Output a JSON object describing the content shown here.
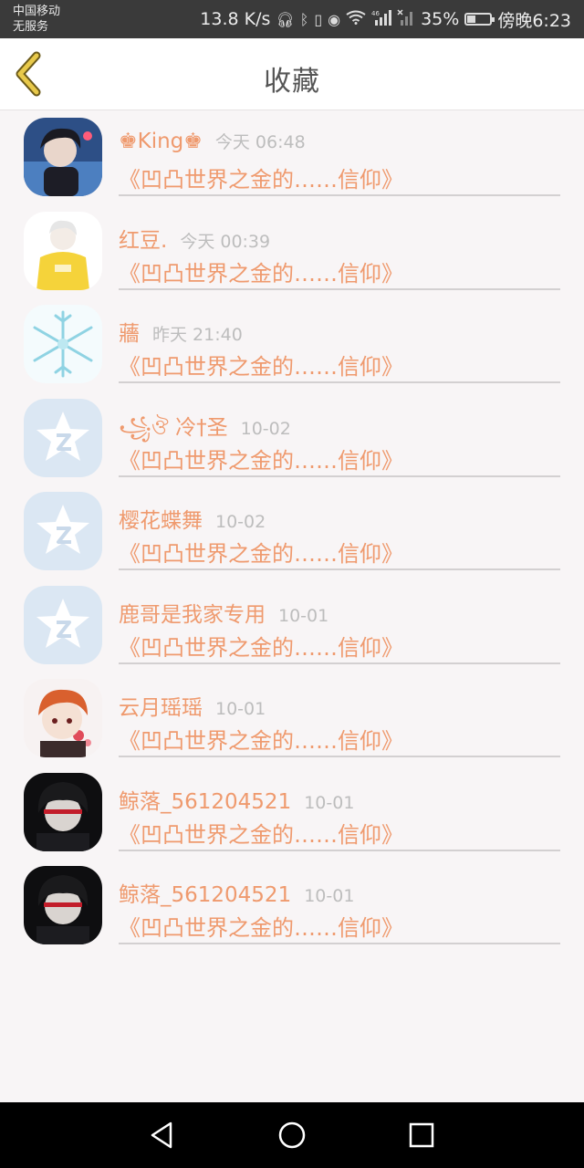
{
  "status_bar": {
    "carrier_line1": "中国移动",
    "carrier_line2": "无服务",
    "speed": "13.8 K/s",
    "network_label": "46",
    "battery_percent": "35%",
    "battery_level": 0.35,
    "time": "傍晚6:23",
    "icons": [
      "headphones-icon",
      "bluetooth-icon",
      "vibrate-icon",
      "eye-icon",
      "wifi-icon",
      "signal-icon",
      "no-signal-icon",
      "battery-icon"
    ]
  },
  "header": {
    "title": "收藏",
    "back_icon": "chevron-left-icon",
    "accent": "#e8c94a"
  },
  "favorites": [
    {
      "name": "♚King♚",
      "time": "今天 06:48",
      "title": "《凹凸世界之金的……信仰》",
      "avatar": "avatar-dark-boy"
    },
    {
      "name": "红豆.",
      "time": "今天 00:39",
      "title": "《凹凸世界之金的……信仰》",
      "avatar": "avatar-yellow-hoodie"
    },
    {
      "name": "蘠",
      "time": "昨天 21:40",
      "title": "《凹凸世界之金的……信仰》",
      "avatar": "avatar-snowflake"
    },
    {
      "name": "꧁ঔ 冷†圣",
      "time": "10-02",
      "title": "《凹凸世界之金的……信仰》",
      "avatar": "avatar-default-qq"
    },
    {
      "name": "樱花蝶舞",
      "time": "10-02",
      "title": "《凹凸世界之金的……信仰》",
      "avatar": "avatar-default-qq"
    },
    {
      "name": "鹿哥是我家专用",
      "time": "10-01",
      "title": "《凹凸世界之金的……信仰》",
      "avatar": "avatar-default-qq"
    },
    {
      "name": "云月瑶瑶",
      "time": "10-01",
      "title": "《凹凸世界之金的……信仰》",
      "avatar": "avatar-anime-redhair"
    },
    {
      "name": "鲸落_561204521",
      "time": "10-01",
      "title": "《凹凸世界之金的……信仰》",
      "avatar": "avatar-anime-dark"
    },
    {
      "name": "鲸落_561204521",
      "time": "10-01",
      "title": "《凹凸世界之金的……信仰》",
      "avatar": "avatar-anime-dark"
    }
  ],
  "colors": {
    "name_text": "#ef9a6e",
    "time_text": "#bdbdbd",
    "background": "#f8f5f6"
  },
  "nav_bar": {
    "icons": [
      "back-triangle-icon",
      "home-circle-icon",
      "recents-square-icon"
    ]
  }
}
